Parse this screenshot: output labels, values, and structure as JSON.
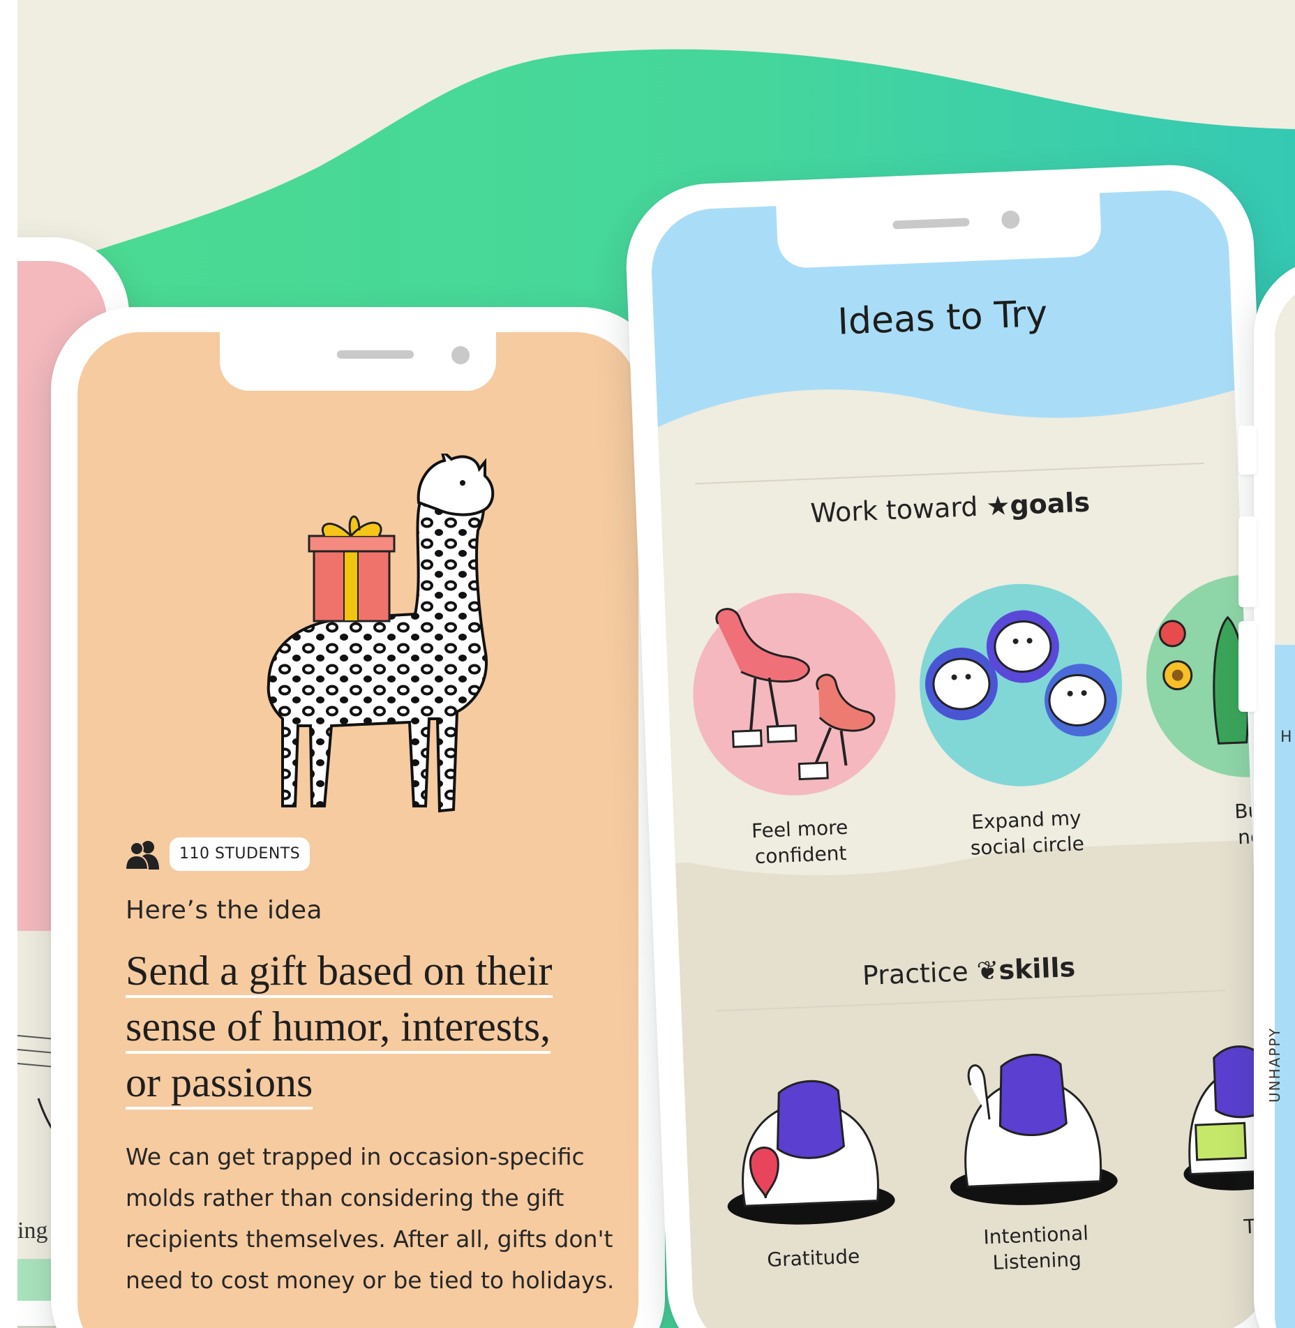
{
  "colors": {
    "background": "#f0eee1",
    "green_wave": "#49d895",
    "orange_screen": "#f6cba0",
    "blue_header": "#a9ddf7",
    "cream_section": "#efece0",
    "tan_section": "#e5dfce",
    "pink_circle": "#f5b8bf",
    "teal_circle": "#80d7d6",
    "green_circle": "#8ed5a7"
  },
  "idea_card": {
    "students_icon": "people-icon",
    "students_badge": "110 STUDENTS",
    "eyebrow": "Here’s the idea",
    "headline_lines": [
      "Send a gift based on their",
      "sense of humor, interests,",
      "or passions"
    ],
    "body": "We can get trapped in occasion-specific molds rather than considering the gift recipients themselves. After all, gifts don't need to cost money or be tied to holidays.",
    "illustration": "llama-with-gift-illustration"
  },
  "ideas_screen": {
    "title": "Ideas to Try",
    "goals_section": {
      "prefix": "Work toward",
      "icon": "star-icon",
      "emphasis": "goals",
      "items": [
        {
          "line1": "Feel more",
          "line2": "confident",
          "illustration": "flamingos-rollerskates-illustration"
        },
        {
          "line1": "Expand my",
          "line2": "social circle",
          "illustration": "otters-holding-hands-illustration"
        },
        {
          "line1": "Buil",
          "line2": "net",
          "illustration": "cactus-flowers-illustration"
        }
      ]
    },
    "skills_section": {
      "prefix": "Practice",
      "icon": "sprout-icon",
      "emphasis": "skills",
      "items": [
        {
          "line1": "Gratitude",
          "line2": "",
          "illustration": "bulldog-heart-illustration"
        },
        {
          "line1": "Intentional",
          "line2": "Listening",
          "illustration": "bulldog-listening-illustration"
        },
        {
          "line1": "Thir",
          "line2": "",
          "illustration": "bulldog-gift-illustration"
        }
      ]
    }
  },
  "far_right_screen": {
    "vertical_label": "UNHAPPY",
    "partial_letter": "H"
  },
  "left_screen": {
    "partial_word": "ing"
  }
}
